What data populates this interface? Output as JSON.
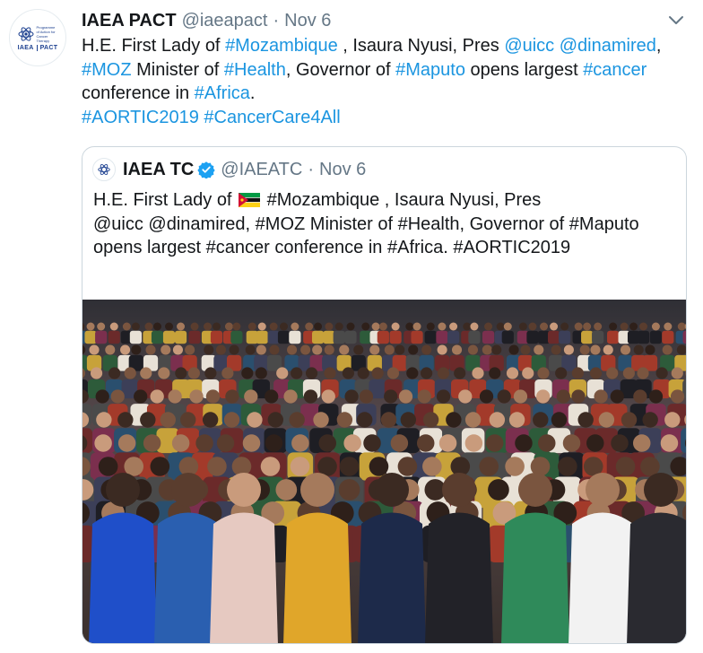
{
  "tweet": {
    "author_name": "IAEA PACT",
    "author_handle": "@iaeapact",
    "separator": "·",
    "date": "Nov 6",
    "avatar_text": "IAEA",
    "avatar_text2": "PACT",
    "avatar_small_text": "Programme of Action for Cancer Therapy",
    "body": [
      {
        "t": "H.E. First Lady of ",
        "link": false
      },
      {
        "t": "#Mozambique",
        "link": true
      },
      {
        "t": " , Isaura Nyusi, Pres ",
        "link": false
      },
      {
        "t": "@uicc",
        "link": true
      },
      {
        "t": " ",
        "link": false
      },
      {
        "t": "@dinamired",
        "link": true
      },
      {
        "t": ", ",
        "link": false
      },
      {
        "t": "#MOZ",
        "link": true
      },
      {
        "t": " Minister of ",
        "link": false
      },
      {
        "t": "#Health",
        "link": true
      },
      {
        "t": ", Governor of ",
        "link": false
      },
      {
        "t": "#Maputo",
        "link": true
      },
      {
        "t": " opens largest ",
        "link": false
      },
      {
        "t": "#cancer",
        "link": true
      },
      {
        "t": " conference in ",
        "link": false
      },
      {
        "t": "#Africa",
        "link": true
      },
      {
        "t": ".",
        "link": false
      },
      {
        "t": "\n",
        "link": false
      },
      {
        "t": "#AORTIC2019",
        "link": true
      },
      {
        "t": " ",
        "link": false
      },
      {
        "t": "#CancerCare4All",
        "link": true
      }
    ],
    "more_icon": "chevron-down-icon"
  },
  "quoted": {
    "author_name": "IAEA TC",
    "author_handle": "@IAEATC",
    "separator": "·",
    "date": "Nov 6",
    "verified_icon": "verified-badge-icon",
    "line1_before_flag": "H.E. First Lady of ",
    "flag_icon": "mozambique-flag-icon",
    "line1_after_flag": " #Mozambique , Isaura Nyusi, Pres",
    "rest": "@uicc @dinamired, #MOZ Minister of #Health, Governor of #Maputo opens largest #cancer conference in #Africa. #AORTIC2019",
    "photo_icon": "conference-group-photo"
  },
  "colors": {
    "link": "#1b95e0",
    "verified": "#1da1f2",
    "muted": "#657786",
    "border": "#ccd6dd"
  }
}
